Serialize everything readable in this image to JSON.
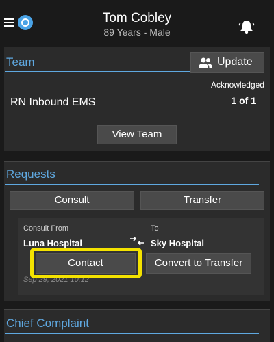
{
  "header": {
    "patient_name": "Tom Cobley",
    "patient_sub": "89 Years - Male",
    "menu_icon": "hamburger-icon",
    "logo_icon": "app-logo-icon",
    "bell_icon": "bell-icon"
  },
  "team": {
    "title": "Team",
    "update_label": "Update",
    "ack_label": "Acknowledged",
    "ack_count": "1 of 1",
    "team_name": "RN Inbound EMS",
    "view_team_label": "View Team"
  },
  "requests": {
    "title": "Requests",
    "tabs": [
      "Consult",
      "Transfer"
    ],
    "card": {
      "from_label": "Consult From",
      "from_value": "Luna Hospital",
      "to_label": "To",
      "to_value": "Sky Hospital",
      "date": "Sep 29, 2021 10:12",
      "contact_label": "Contact",
      "convert_label": "Convert to Transfer"
    }
  },
  "chief_complaint": {
    "title": "Chief Complaint"
  },
  "colors": {
    "accent": "#5fa8e0",
    "highlight": "#f4e200",
    "background": "#1a1a1a",
    "panel": "#2b2b2b"
  }
}
